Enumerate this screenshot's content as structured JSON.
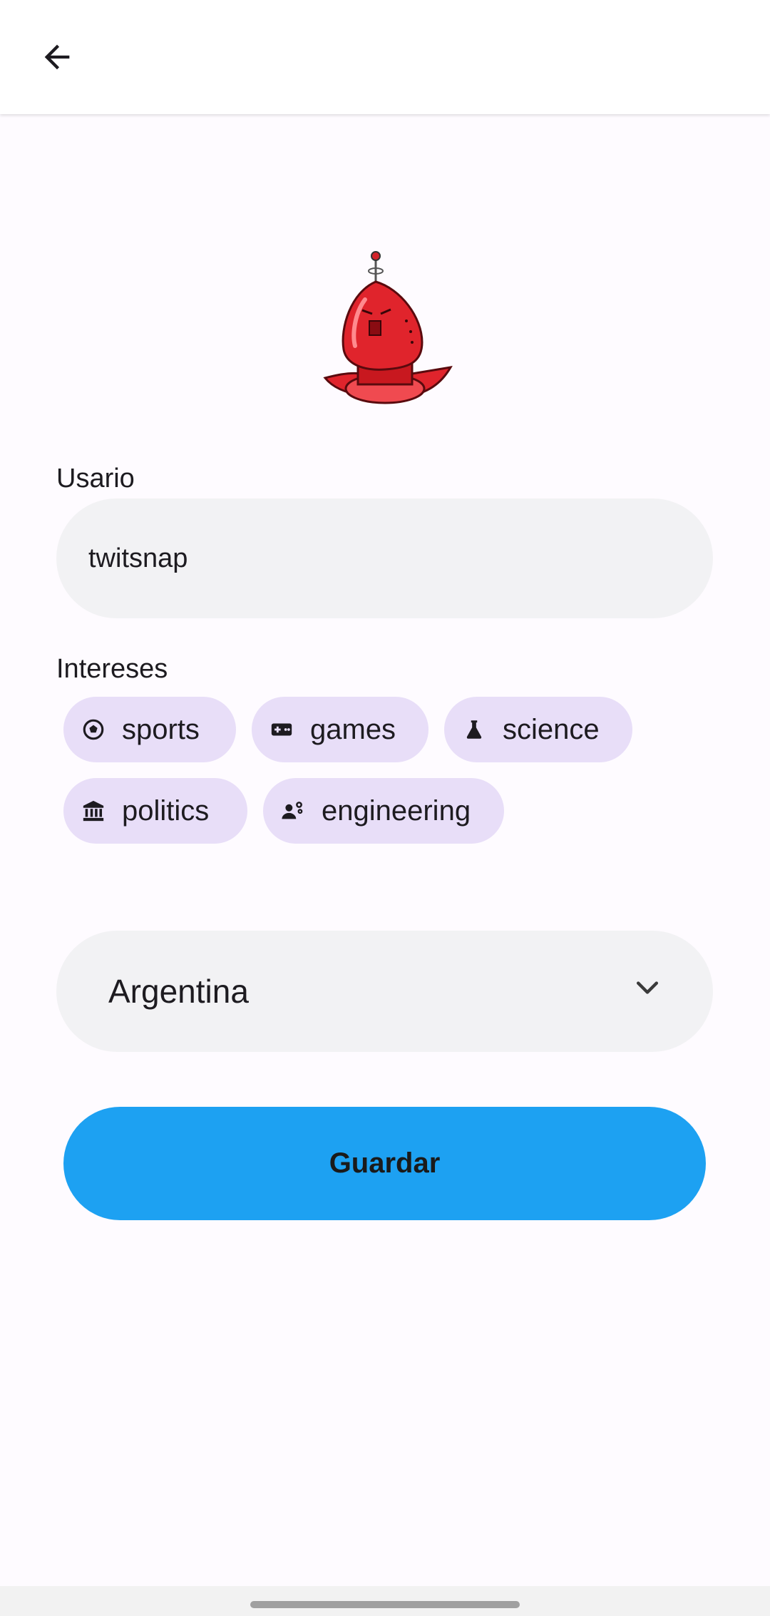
{
  "header": {
    "back_icon": "arrow-back-icon"
  },
  "profile": {
    "avatar_icon": "red-robot-avatar"
  },
  "user": {
    "label": "Usario",
    "value": "twitsnap"
  },
  "interests": {
    "label": "Intereses",
    "chips": [
      {
        "label": "sports",
        "icon": "soccer-ball-icon"
      },
      {
        "label": "games",
        "icon": "gamepad-icon"
      },
      {
        "label": "science",
        "icon": "flask-icon"
      },
      {
        "label": "politics",
        "icon": "institution-icon"
      },
      {
        "label": "engineering",
        "icon": "engineering-icon"
      }
    ]
  },
  "country": {
    "selected": "Argentina",
    "icon": "chevron-down-icon"
  },
  "actions": {
    "save_label": "Guardar"
  },
  "colors": {
    "primary_button": "#1da1f2",
    "chip_background": "#e8def8",
    "field_background": "#f2f2f4",
    "avatar_red": "#e0242c"
  }
}
